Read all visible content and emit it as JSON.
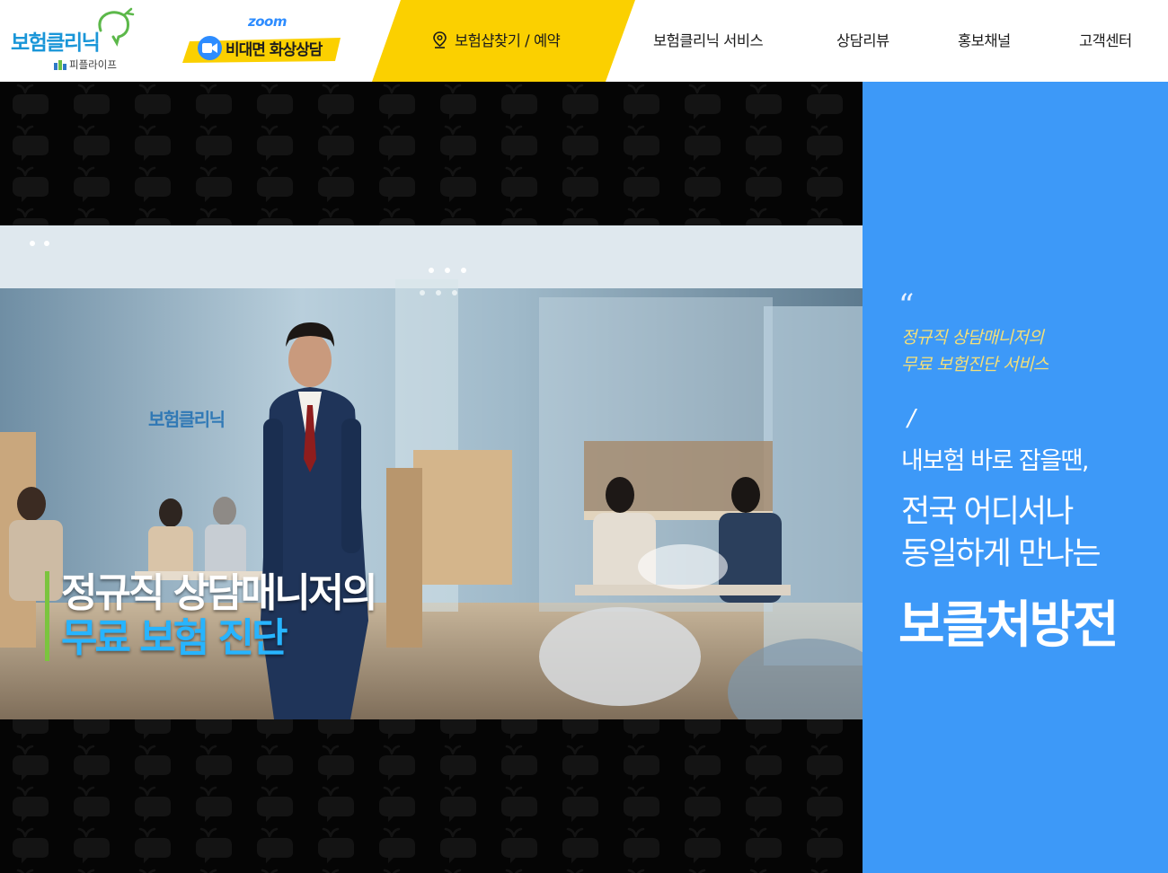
{
  "brand": {
    "logo_text": "보험클리닉",
    "sub_text": "피플라이프",
    "primary_color": "#1a96d8",
    "accent_green": "#7bc43e"
  },
  "zoom": {
    "logo": "zoom",
    "label": "비대면 화상상담",
    "icon": "video-camera-icon",
    "color": "#2d8cff"
  },
  "nav": {
    "highlight_color": "#fbd000",
    "find_shop": {
      "label": "보험샵찾기 / 예약",
      "icon": "location-pin-icon"
    },
    "items": [
      {
        "label": "보험클리닉 서비스"
      },
      {
        "label": "상담리뷰"
      },
      {
        "label": "홍보채널"
      },
      {
        "label": "고객센터"
      }
    ]
  },
  "hero": {
    "wall_logo": "보험클리닉",
    "caption_line1": "정규직 상담매니저의",
    "caption_line2": "무료 보험 진단",
    "caption_line2_color": "#27b4ff"
  },
  "side_panel": {
    "background": "#3d99f8",
    "quote_mark": "“",
    "quote_line1": "정규직 상담매니저의",
    "quote_line2": "무료 보험진단 서비스",
    "divider": "/",
    "line1": "내보험 바로 잡을땐,",
    "line2": "전국 어디서나",
    "line3": "동일하게 만나는",
    "line4": "보클처방전"
  }
}
